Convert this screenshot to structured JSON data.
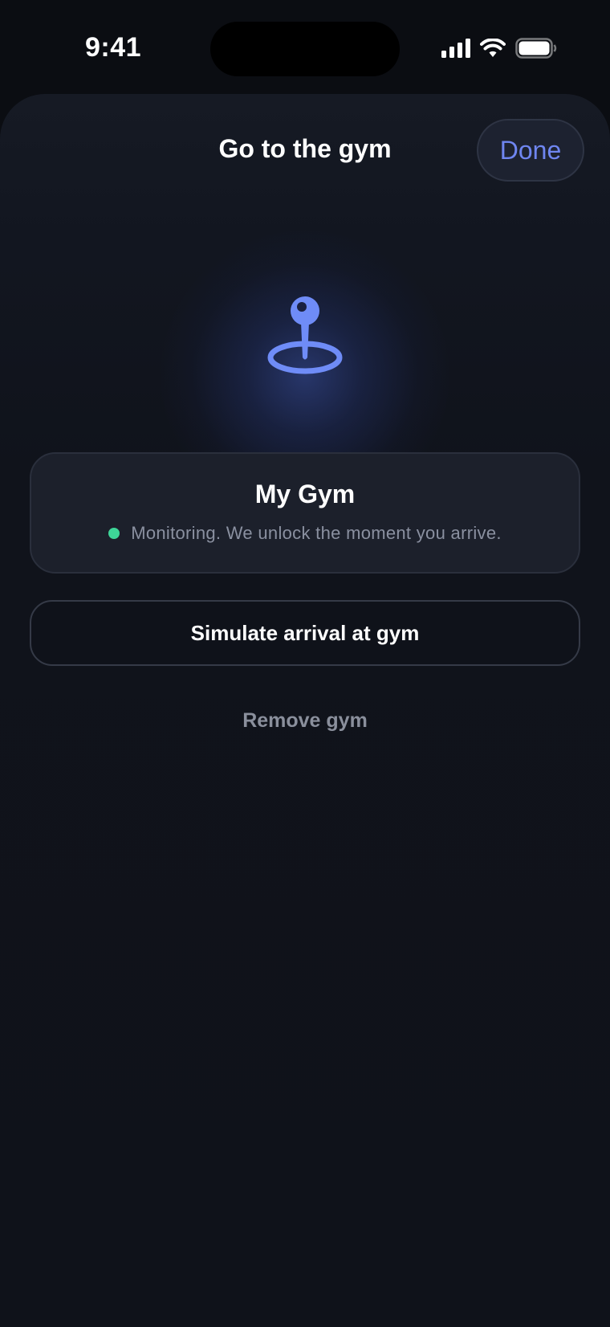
{
  "status_bar": {
    "time": "9:41",
    "icons": [
      "cellular-signal-icon",
      "wifi-icon",
      "battery-icon"
    ]
  },
  "sheet": {
    "title": "Go to the gym",
    "done_label": "Done",
    "hero_icon": "location-pin-icon"
  },
  "location_card": {
    "name": "My Gym",
    "status_text": "Monitoring. We unlock the moment you arrive."
  },
  "actions": {
    "simulate_label": "Simulate arrival at gym",
    "remove_label": "Remove gym"
  },
  "colors": {
    "background": "#0b0d12",
    "accent": "#6f86f0",
    "status_active": "#3ed598",
    "card": "#1c202b",
    "muted_text": "#8a90a0"
  }
}
